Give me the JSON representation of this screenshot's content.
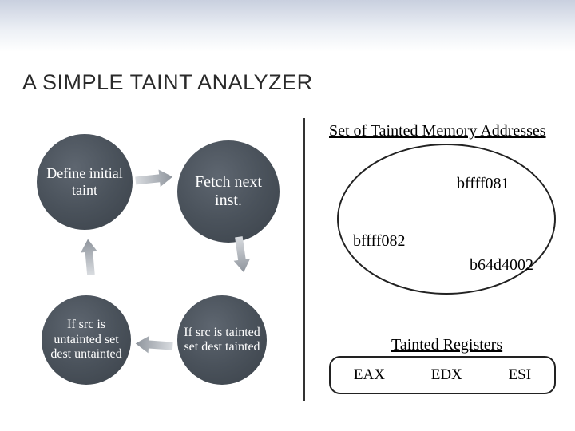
{
  "title": "A SIMPLE TAINT ANALYZER",
  "cycle": {
    "n1": "Define initial taint",
    "n2": "Fetch next inst.",
    "n3": "If src is tainted set dest tainted",
    "n4": "If src is untainted set dest untainted"
  },
  "memory": {
    "heading": "Set of Tainted Memory Addresses",
    "addrs": [
      "bffff081",
      "bffff082",
      "b64d4002"
    ]
  },
  "registers": {
    "heading": "Tainted Registers",
    "items": [
      "EAX",
      "EDX",
      "ESI"
    ]
  }
}
